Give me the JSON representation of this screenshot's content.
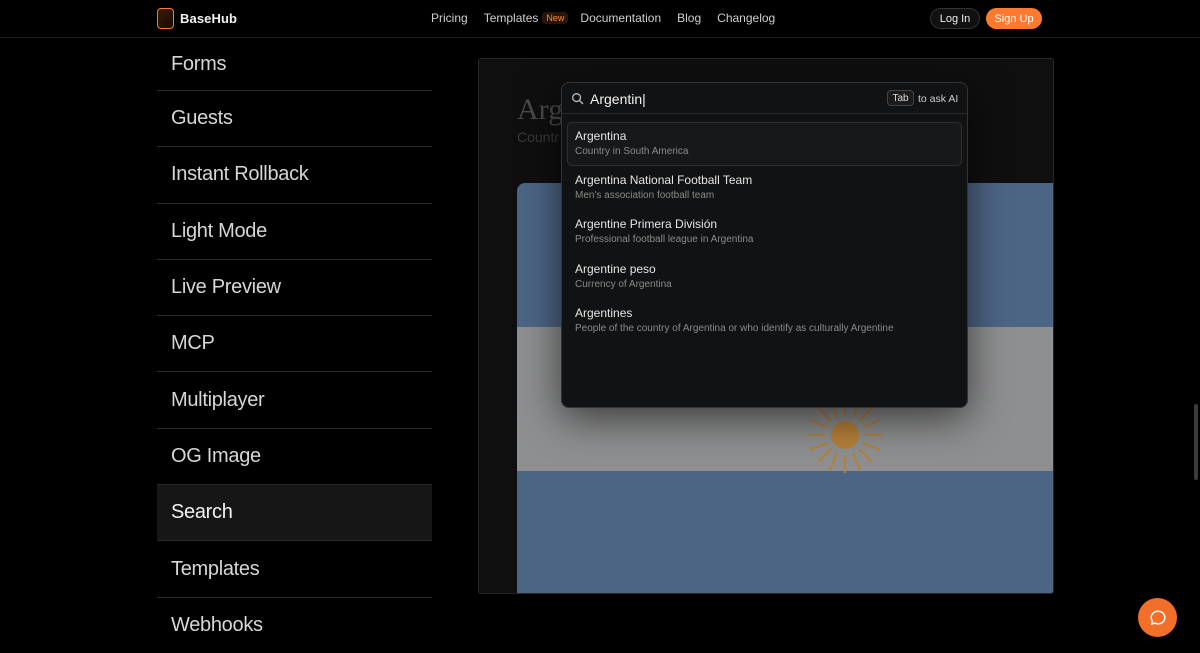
{
  "header": {
    "brand": "BaseHub",
    "nav": [
      "Pricing",
      "Templates",
      "Documentation",
      "Blog",
      "Changelog"
    ],
    "templates_badge": "New",
    "login": "Log In",
    "signup": "Sign Up"
  },
  "sidebar": {
    "items": [
      {
        "label": "Forms"
      },
      {
        "label": "Guests"
      },
      {
        "label": "Instant Rollback"
      },
      {
        "label": "Light Mode"
      },
      {
        "label": "Live Preview"
      },
      {
        "label": "MCP"
      },
      {
        "label": "Multiplayer"
      },
      {
        "label": "OG Image"
      },
      {
        "label": "Search"
      },
      {
        "label": "Templates"
      },
      {
        "label": "Webhooks"
      }
    ],
    "active": "Search"
  },
  "preview": {
    "bg_title": "Arg",
    "bg_subtitle": "Countr"
  },
  "search": {
    "value": "Argentin|",
    "tab_key": "Tab",
    "ask_ai": "to ask AI",
    "results": [
      {
        "title": "Argentina",
        "subtitle": "Country in South America"
      },
      {
        "title": "Argentina National Football Team",
        "subtitle": "Men's association football team"
      },
      {
        "title": "Argentine Primera División",
        "subtitle": "Professional football league in Argentina"
      },
      {
        "title": "Argentine peso",
        "subtitle": "Currency of Argentina"
      },
      {
        "title": "Argentines",
        "subtitle": "People of the country of Argentina or who identify as culturally Argentine"
      }
    ]
  },
  "colors": {
    "accent": "#ff7a2e",
    "background": "#000000",
    "flag_blue": "#4d6585",
    "flag_white": "#8e8f90",
    "sun": "#b5813a"
  },
  "icons": {
    "search": "search-icon",
    "chat": "chat-bubble-icon",
    "logo": "basehub-logo-icon"
  }
}
